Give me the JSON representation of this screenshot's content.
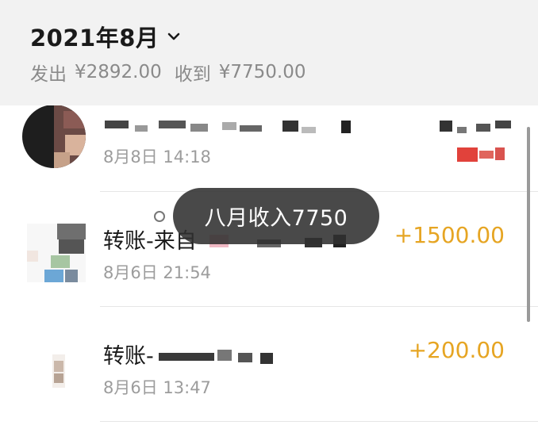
{
  "header": {
    "month": "2021年8月",
    "expense_label": "发出",
    "expense_amount": "¥2892.00",
    "income_label": "收到",
    "income_amount": "¥7750.00"
  },
  "transactions": [
    {
      "title": "",
      "time": "8月8日 14:18",
      "amount": ""
    },
    {
      "title": "转账-来自",
      "time": "8月6日 21:54",
      "amount": "+1500.00"
    },
    {
      "title": "转账-",
      "time": "8月6日 13:47",
      "amount": "+200.00"
    }
  ],
  "toast": {
    "text": "八月收入7750"
  },
  "colors": {
    "income": "#e6a523",
    "header_bg": "#f2f2f2",
    "toast_bg": "#303030"
  }
}
